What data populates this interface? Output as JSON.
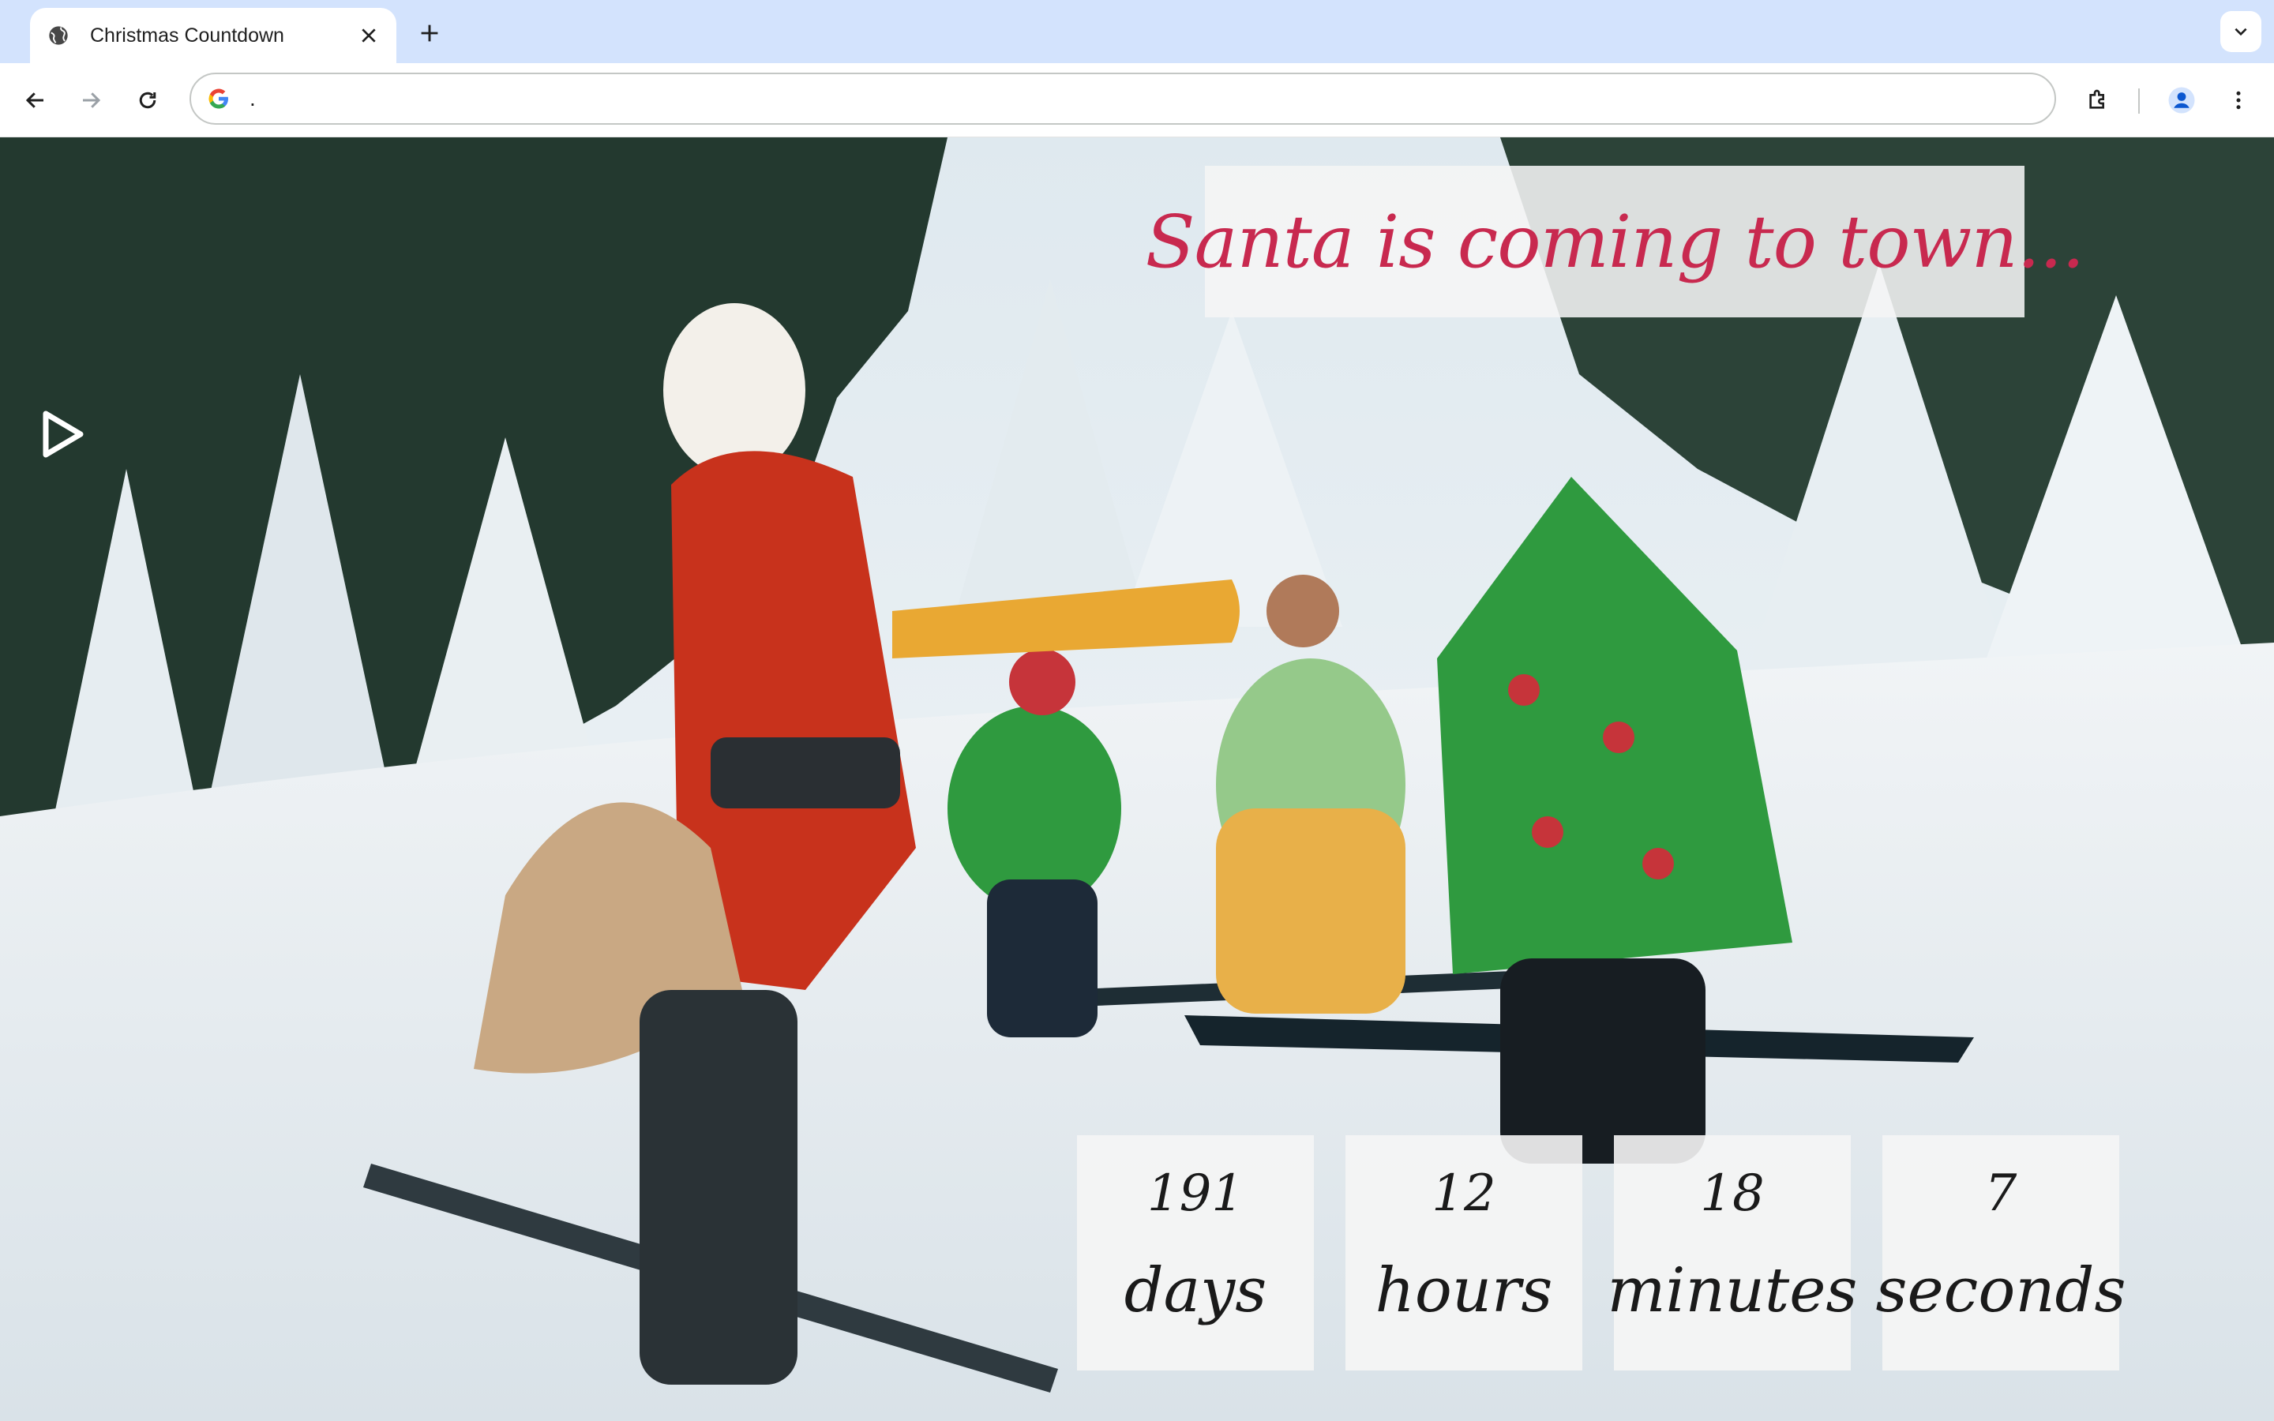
{
  "browser": {
    "tab_title": "Christmas Countdown",
    "address": ".",
    "icons": [
      "globe-icon",
      "close-icon",
      "plus-icon",
      "chevron-down-icon",
      "back-arrow-icon",
      "forward-arrow-icon",
      "reload-icon",
      "google-icon",
      "extensions-icon",
      "profile-icon",
      "kebab-menu-icon"
    ]
  },
  "page": {
    "headline": "Santa is coming to town...",
    "headline_color": "#c8294f",
    "play_icon": "play-icon",
    "countdown": [
      {
        "value": "191",
        "unit": "days"
      },
      {
        "value": "12",
        "unit": "hours"
      },
      {
        "value": "18",
        "unit": "minutes"
      },
      {
        "value": "7",
        "unit": "seconds"
      }
    ]
  }
}
